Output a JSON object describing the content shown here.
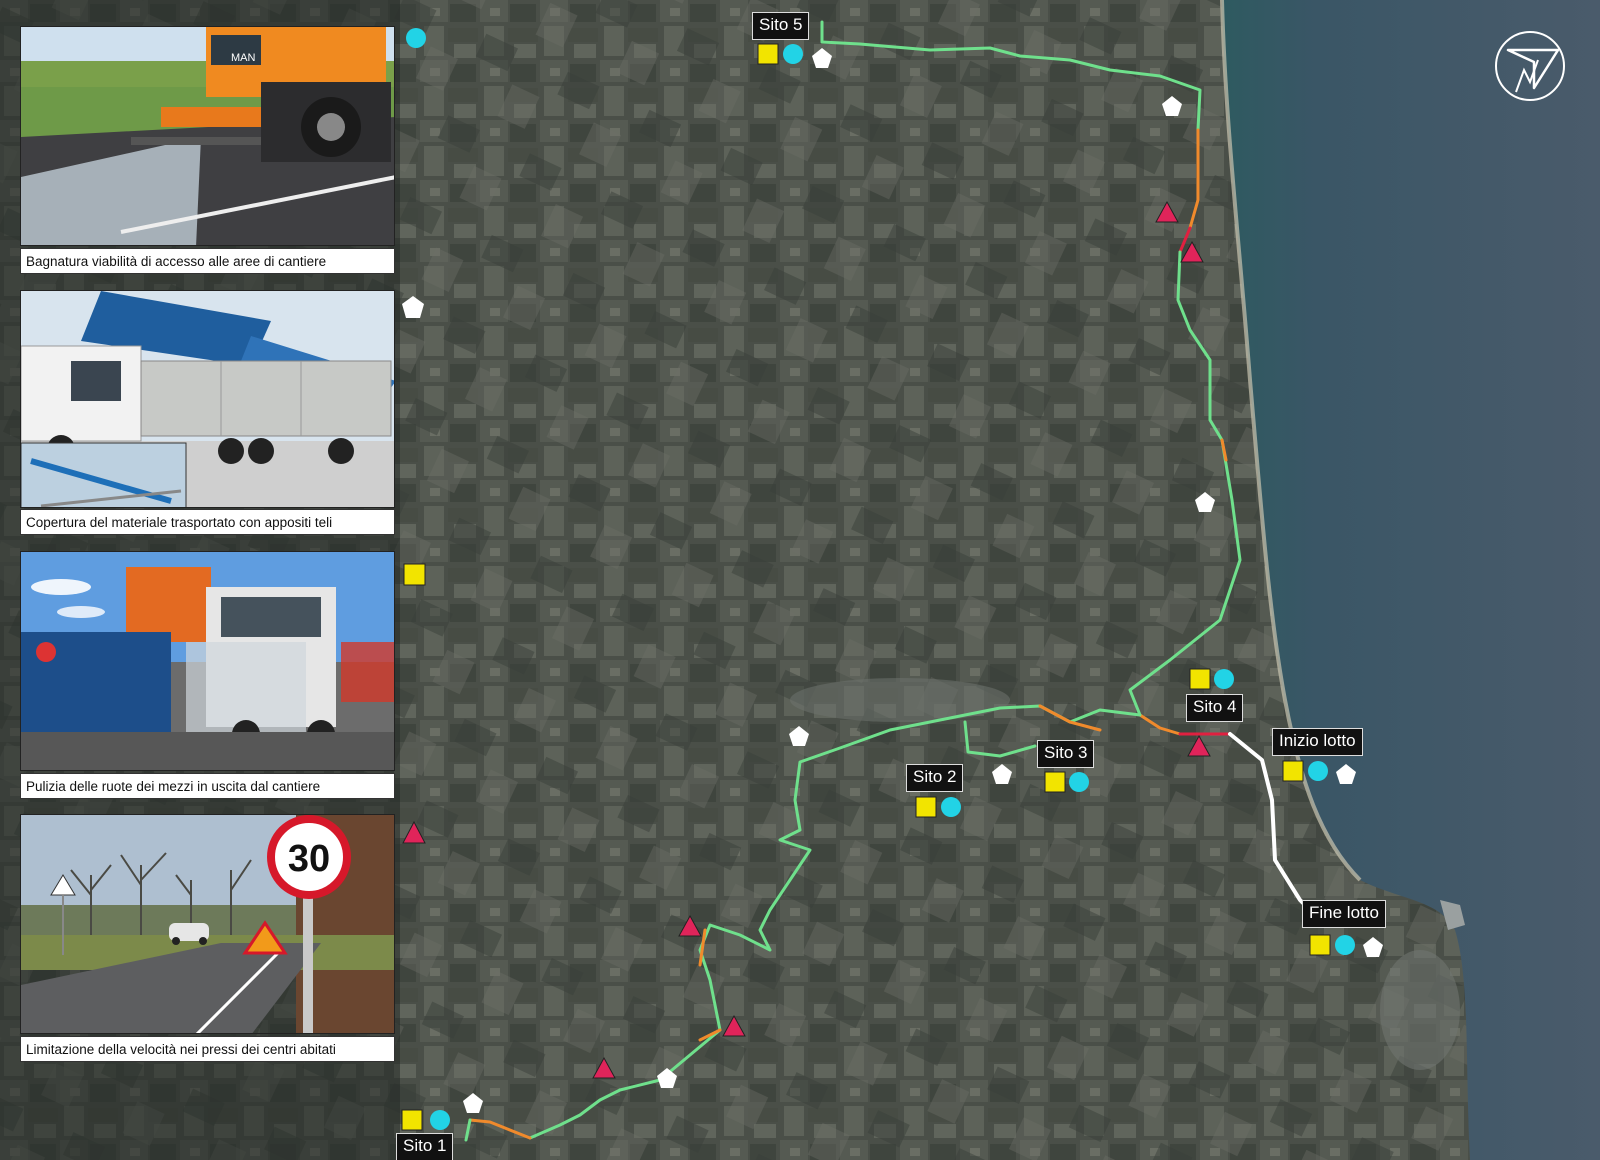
{
  "captions": [
    "Bagnatura viabilità di accesso alle aree di cantiere",
    "Copertura del materiale trasportato con appositi teli",
    "Pulizia delle ruote dei mezzi in uscita dal cantiere",
    "Limitazione della velocità nei pressi dei centri abitati"
  ],
  "sites": {
    "sito1": "Sito 1",
    "sito2": "Sito 2",
    "sito3": "Sito 3",
    "sito4": "Sito 4",
    "sito5": "Sito 5",
    "inizio_lotto": "Inizio lotto",
    "fine_lotto": "Fine lotto"
  },
  "speed_sign": "30",
  "truck_brand": "MAN",
  "colors": {
    "route_green": "#6fe08c",
    "route_orange": "#f08a2c",
    "route_red": "#e02040",
    "route_white": "#ffffff",
    "marker_yellow": "#f2e400",
    "marker_cyan": "#22d3e6",
    "marker_red_triangle": "#e0245a",
    "marker_white_pentagon": "#ffffff",
    "sea": "#3e4f5e"
  },
  "legend_marker_icons": [
    "cyan-circle-icon",
    "white-pentagon-icon",
    "yellow-square-icon",
    "red-triangle-icon"
  ]
}
